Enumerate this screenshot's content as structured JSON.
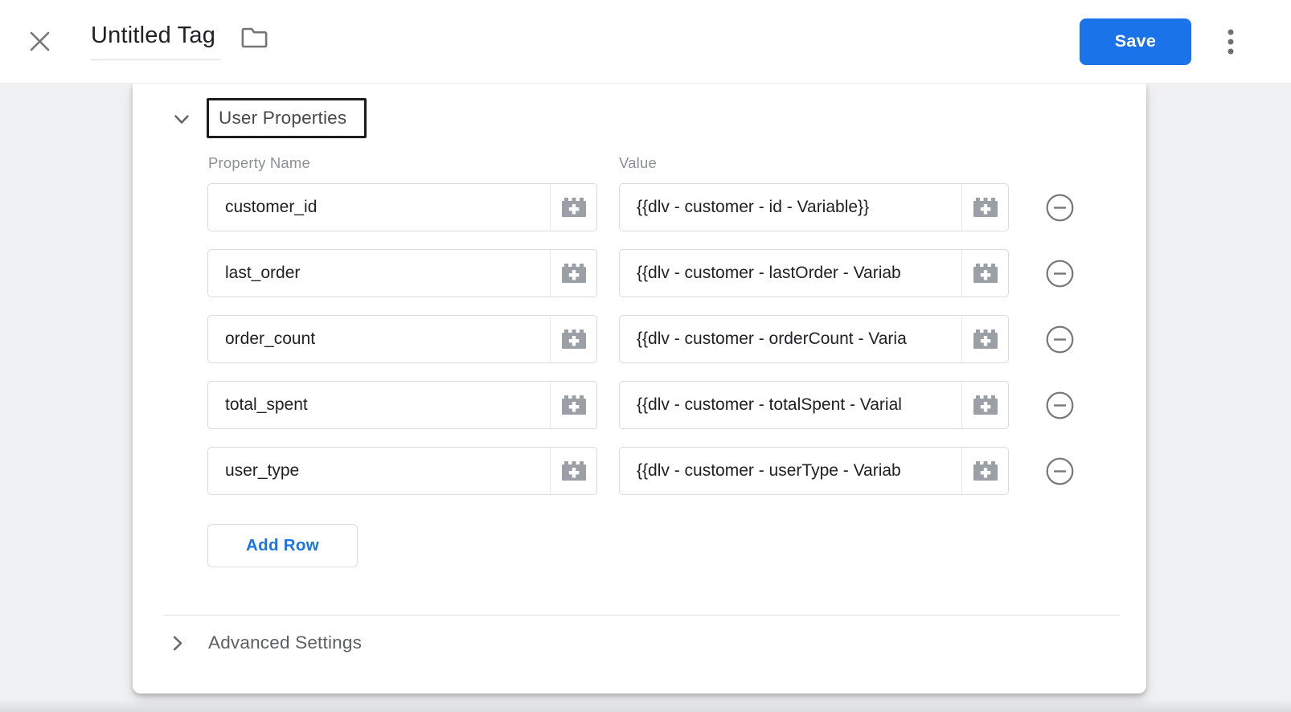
{
  "header": {
    "title": "Untitled Tag",
    "save_label": "Save"
  },
  "panel": {
    "section_title": "User Properties",
    "columns": {
      "property_name": "Property Name",
      "value": "Value"
    },
    "rows": [
      {
        "name": "customer_id",
        "value": "{{dlv - customer - id - Variable}}"
      },
      {
        "name": "last_order",
        "value": "{{dlv - customer - lastOrder - Variab"
      },
      {
        "name": "order_count",
        "value": "{{dlv - customer - orderCount - Varia"
      },
      {
        "name": "total_spent",
        "value": "{{dlv - customer - totalSpent - Varial"
      },
      {
        "name": "user_type",
        "value": "{{dlv - customer - userType - Variab"
      }
    ],
    "add_row_label": "Add Row",
    "advanced_settings_label": "Advanced Settings"
  },
  "icons": {
    "close": "x-cross",
    "folder": "folder-outline",
    "menu": "kebab-vertical-dots",
    "collapse": "chevron-down",
    "expand": "chevron-right",
    "variable_picker": "lego-brick-plus",
    "remove_row": "minus-circle"
  },
  "colors": {
    "accent_blue": "#1a73e8",
    "input_border": "#dadce0",
    "text_primary": "#202124",
    "text_secondary": "#8b9095",
    "icon_gray": "#9aa0a6",
    "background_gray": "#f0f1f2",
    "focus_ring": "#1c1c1c"
  }
}
